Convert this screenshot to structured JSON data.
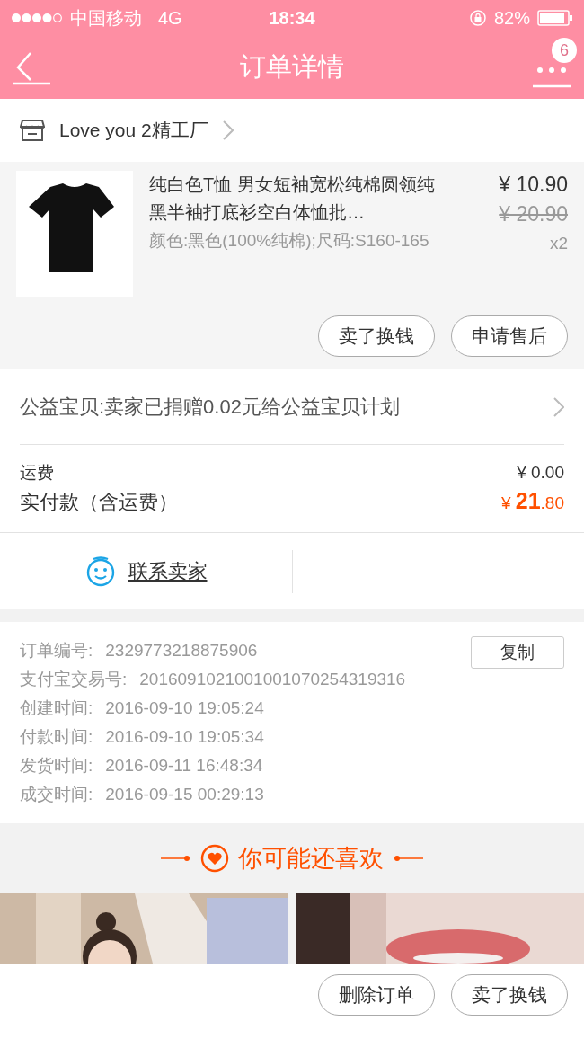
{
  "status_bar": {
    "carrier": "中国移动",
    "network": "4G",
    "time": "18:34",
    "battery": "82%"
  },
  "nav": {
    "title": "订单详情",
    "badge": "6"
  },
  "shop": {
    "name": "Love you 2精工厂"
  },
  "item": {
    "title": "纯白色T恤 男女短袖宽松纯棉圆领纯黑半袖打底衫空白体恤批…",
    "spec": "颜色:黑色(100%纯棉);尺码:S160-165",
    "price": "¥ 10.90",
    "original_price": "¥ 20.90",
    "quantity": "x2",
    "buttons": [
      "卖了换钱",
      "申请售后"
    ]
  },
  "charity": {
    "text": "公益宝贝:卖家已捐赠0.02元给公益宝贝计划"
  },
  "fees": {
    "shipping_label": "运费",
    "shipping_value": "¥ 0.00",
    "total_label": "实付款（含运费）",
    "total_currency": "¥",
    "total_integer": "21",
    "total_decimal": ".80"
  },
  "contact": {
    "label": "联系卖家"
  },
  "order_info": {
    "copy_button": "复制",
    "rows": [
      {
        "label": "订单编号:",
        "value": "2329773218875906"
      },
      {
        "label": "支付宝交易号:",
        "value": "2016091021001001070254319316"
      },
      {
        "label": "创建时间:",
        "value": "2016-09-10 19:05:24"
      },
      {
        "label": "付款时间:",
        "value": "2016-09-10 19:05:34"
      },
      {
        "label": "发货时间:",
        "value": "2016-09-11 16:48:34"
      },
      {
        "label": "成交时间:",
        "value": "2016-09-15 00:29:13"
      }
    ]
  },
  "recommend": {
    "title": "你可能还喜欢"
  },
  "bottom_bar": {
    "buttons": [
      "删除订单",
      "卖了换钱"
    ]
  }
}
